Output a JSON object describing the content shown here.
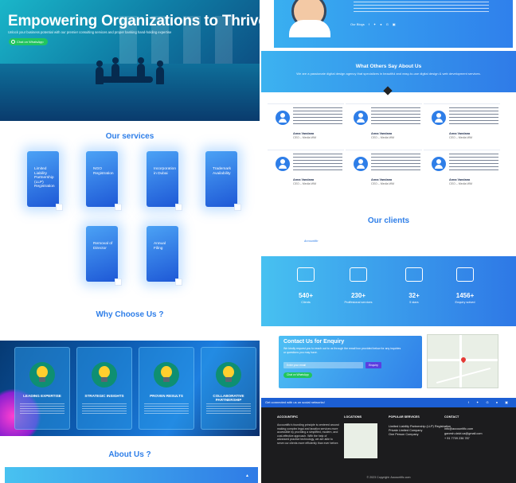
{
  "hero": {
    "title": "Empowering Organizations to Thrive",
    "subtitle": "Unlock your business potential with our premier consulting services and proper banking hand-holding expertise",
    "whatsapp_label": "Chat on WhatsApp"
  },
  "services": {
    "title": "Our services",
    "items": [
      {
        "label": "Limited Liability Partnership (LLP) Registration"
      },
      {
        "label": "NGO Registration"
      },
      {
        "label": "Incorporation in Dubai"
      },
      {
        "label": "Trademark Availability"
      },
      {
        "label": "Removal of Director"
      },
      {
        "label": "Annual Filing"
      }
    ]
  },
  "why": {
    "title": "Why Choose Us ?",
    "cards": [
      {
        "title": "LEADING EXPERTISE"
      },
      {
        "title": "STRATEGIC INSIGHTS"
      },
      {
        "title": "PROVEN RESULTS"
      },
      {
        "title": "COLLABORATIVE PARTNERSHIP"
      }
    ]
  },
  "about": {
    "title": "About Us ?"
  },
  "topcard": {
    "social_label": "Our Blogs"
  },
  "testimonials": {
    "title": "What Others Say About Us",
    "subtitle": "We are a passionate digital design agency that specializes in beautiful and easy-to-use digital design & web development services.",
    "cards": [
      {
        "name": "Anna Vandana",
        "role": "CEO – Media WM"
      },
      {
        "name": "Anna Vandana",
        "role": "CEO – Media WM"
      },
      {
        "name": "Anna Vandana",
        "role": "CEO – Media WM"
      },
      {
        "name": "Anna Vandana",
        "role": "CEO – Media WM"
      },
      {
        "name": "Anna Vandana",
        "role": "CEO – Media WM"
      },
      {
        "name": "Anna Vandana",
        "role": "CEO – Media WM"
      }
    ]
  },
  "clients": {
    "title": "Our clients",
    "logo_text": "Accountific"
  },
  "stats": [
    {
      "value": "540+",
      "label": "Clients",
      "icon": "certificate-icon"
    },
    {
      "value": "230+",
      "label": "Proffesional services",
      "icon": "gears-icon"
    },
    {
      "value": "32+",
      "label": "5 stars",
      "icon": "star-rating-icon"
    },
    {
      "value": "1456+",
      "label": "Enquiry solved",
      "icon": "puzzle-icon"
    }
  ],
  "contact": {
    "title": "Contact Us for Enquiry",
    "text": "We kindly request you to reach out to us through the email box provided below for any inquiries or questions you may have.",
    "email_placeholder": "Enter your email",
    "enquiry_label": "Enquiry",
    "whatsapp_label": "Chat on WhatsApp"
  },
  "social_strip": {
    "text": "Get connected with us on social networks!"
  },
  "footer": {
    "col1_title": "ACCOUNTIFIC",
    "col1_text": "Accountific's founding principle is centered around making complex legal and taxation services more accessible by providing a simplified, modern, and cost-effective approach. With the help of advanced practice technology, we are able to serve our clients more efficiently than ever before.",
    "col2_title": "LOCATIONS",
    "col3_title": "POPULAR SERVICES",
    "col3_items": [
      "Limited Liability Partnership (LLP) Registration",
      "Private Limited Company",
      "One Person Company"
    ],
    "col4_title": "CONTACT",
    "col4_items": [
      "info@accountific.com",
      "ganesh.dalvi.ca@gmail.com",
      "+ 91 7709 236 787"
    ],
    "copyright": "© 2023 Copyright: Accountific.com"
  },
  "colors": {
    "accent": "#2e7ee8",
    "whatsapp": "#22c55e",
    "footer_bg": "#1c1c1e"
  }
}
